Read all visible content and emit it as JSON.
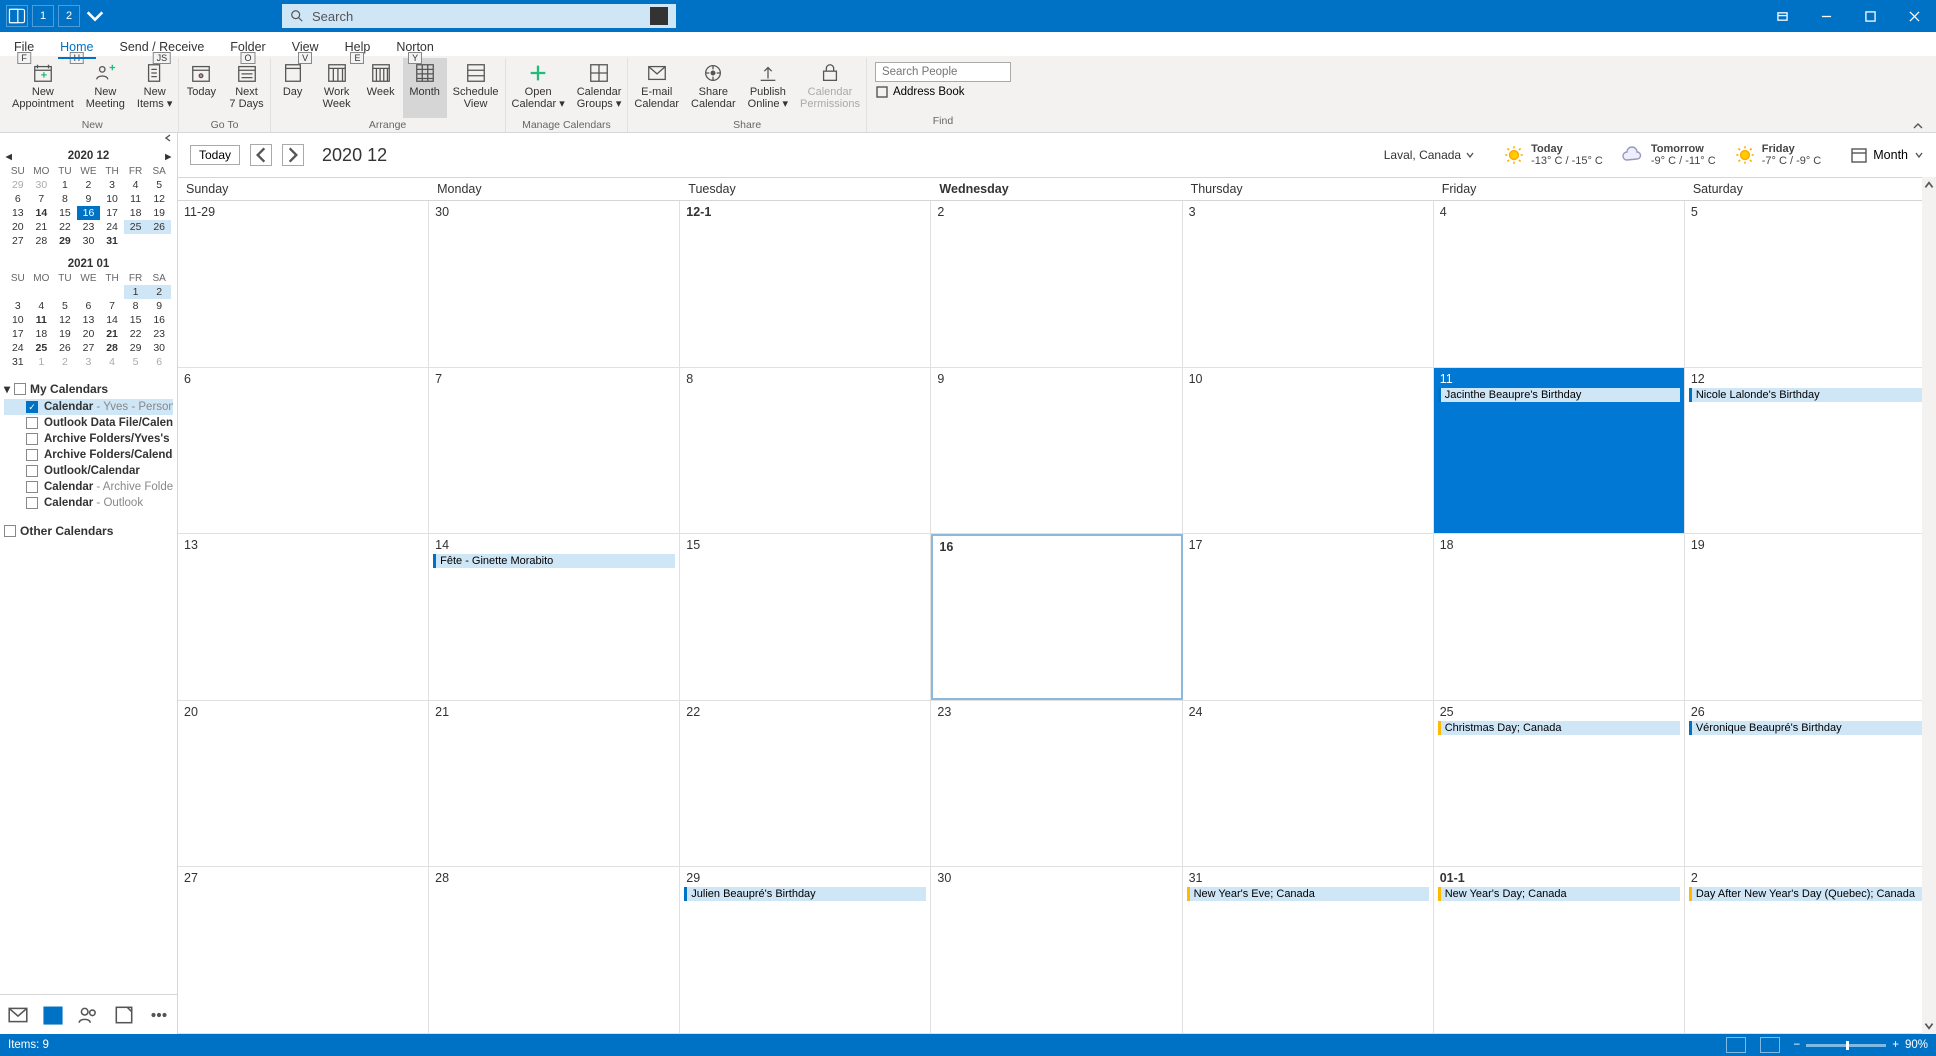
{
  "titlebar": {
    "search_placeholder": "Search",
    "qat": [
      "1",
      "2"
    ]
  },
  "tabs": {
    "items": [
      "File",
      "Home",
      "Send / Receive",
      "Folder",
      "View",
      "Help",
      "Norton"
    ],
    "active": "Home",
    "keys": [
      "F",
      "H",
      "JS",
      "O",
      "V",
      "E",
      "Y"
    ]
  },
  "ribbon": {
    "groups": [
      {
        "label": "New",
        "buttons": [
          {
            "id": "new-appointment",
            "l1": "New",
            "l2": "Appointment",
            "icon": "cal-plus"
          },
          {
            "id": "new-meeting",
            "l1": "New",
            "l2": "Meeting",
            "icon": "people-plus"
          },
          {
            "id": "new-items",
            "l1": "New",
            "l2": "Items ▾",
            "icon": "page"
          }
        ]
      },
      {
        "label": "Go To",
        "buttons": [
          {
            "id": "today",
            "l1": "Today",
            "l2": "",
            "icon": "cal-dot"
          },
          {
            "id": "next7",
            "l1": "Next",
            "l2": "7 Days",
            "icon": "cal-week"
          }
        ]
      },
      {
        "label": "Arrange",
        "buttons": [
          {
            "id": "day",
            "l1": "Day",
            "l2": "",
            "icon": "view-day"
          },
          {
            "id": "workweek",
            "l1": "Work",
            "l2": "Week",
            "icon": "view-ww"
          },
          {
            "id": "week",
            "l1": "Week",
            "l2": "",
            "icon": "view-week"
          },
          {
            "id": "month",
            "l1": "Month",
            "l2": "",
            "icon": "view-month",
            "active": true
          },
          {
            "id": "schedule",
            "l1": "Schedule",
            "l2": "View",
            "icon": "view-sched"
          }
        ]
      },
      {
        "label": "Manage Calendars",
        "buttons": [
          {
            "id": "open-cal",
            "l1": "Open",
            "l2": "Calendar ▾",
            "icon": "plus-green"
          },
          {
            "id": "cal-groups",
            "l1": "Calendar",
            "l2": "Groups ▾",
            "icon": "grid"
          }
        ]
      },
      {
        "label": "Share",
        "buttons": [
          {
            "id": "email-cal",
            "l1": "E-mail",
            "l2": "Calendar",
            "icon": "mail"
          },
          {
            "id": "share-cal",
            "l1": "Share",
            "l2": "Calendar",
            "icon": "share"
          },
          {
            "id": "publish",
            "l1": "Publish",
            "l2": "Online ▾",
            "icon": "upload"
          },
          {
            "id": "perms",
            "l1": "Calendar",
            "l2": "Permissions",
            "icon": "lock",
            "disabled": true
          }
        ]
      }
    ],
    "find": {
      "placeholder": "Search People",
      "addressbook": "Address Book",
      "label": "Find"
    }
  },
  "sidebar": {
    "mini1": {
      "title": "2020 12",
      "dow": [
        "SU",
        "MO",
        "TU",
        "WE",
        "TH",
        "FR",
        "SA"
      ],
      "rows": [
        [
          {
            "n": "29",
            "dim": true
          },
          {
            "n": "30",
            "dim": true
          },
          {
            "n": "1"
          },
          {
            "n": "2"
          },
          {
            "n": "3"
          },
          {
            "n": "4"
          },
          {
            "n": "5"
          }
        ],
        [
          {
            "n": "6"
          },
          {
            "n": "7"
          },
          {
            "n": "8"
          },
          {
            "n": "9"
          },
          {
            "n": "10"
          },
          {
            "n": "11"
          },
          {
            "n": "12"
          }
        ],
        [
          {
            "n": "13"
          },
          {
            "n": "14",
            "bold": true
          },
          {
            "n": "15"
          },
          {
            "n": "16",
            "today": true
          },
          {
            "n": "17"
          },
          {
            "n": "18"
          },
          {
            "n": "19"
          }
        ],
        [
          {
            "n": "20"
          },
          {
            "n": "21"
          },
          {
            "n": "22"
          },
          {
            "n": "23"
          },
          {
            "n": "24"
          },
          {
            "n": "25",
            "range": true
          },
          {
            "n": "26",
            "range": true
          }
        ],
        [
          {
            "n": "27"
          },
          {
            "n": "28"
          },
          {
            "n": "29",
            "bold": true
          },
          {
            "n": "30"
          },
          {
            "n": "31",
            "bold": true
          },
          {
            "n": "",
            "dim": true
          },
          {
            "n": "",
            "dim": true
          }
        ]
      ]
    },
    "mini2": {
      "title": "2021 01",
      "dow": [
        "SU",
        "MO",
        "TU",
        "WE",
        "TH",
        "FR",
        "SA"
      ],
      "rows": [
        [
          {
            "n": ""
          },
          {
            "n": ""
          },
          {
            "n": ""
          },
          {
            "n": ""
          },
          {
            "n": ""
          },
          {
            "n": "1",
            "range": true
          },
          {
            "n": "2",
            "range": true
          }
        ],
        [
          {
            "n": "3"
          },
          {
            "n": "4"
          },
          {
            "n": "5"
          },
          {
            "n": "6"
          },
          {
            "n": "7"
          },
          {
            "n": "8"
          },
          {
            "n": "9"
          }
        ],
        [
          {
            "n": "10"
          },
          {
            "n": "11",
            "bold": true
          },
          {
            "n": "12"
          },
          {
            "n": "13"
          },
          {
            "n": "14"
          },
          {
            "n": "15"
          },
          {
            "n": "16"
          }
        ],
        [
          {
            "n": "17"
          },
          {
            "n": "18"
          },
          {
            "n": "19"
          },
          {
            "n": "20"
          },
          {
            "n": "21",
            "bold": true
          },
          {
            "n": "22"
          },
          {
            "n": "23"
          }
        ],
        [
          {
            "n": "24"
          },
          {
            "n": "25",
            "bold": true
          },
          {
            "n": "26"
          },
          {
            "n": "27"
          },
          {
            "n": "28",
            "bold": true
          },
          {
            "n": "29"
          },
          {
            "n": "30"
          }
        ],
        [
          {
            "n": "31"
          },
          {
            "n": "1",
            "dim": true
          },
          {
            "n": "2",
            "dim": true
          },
          {
            "n": "3",
            "dim": true
          },
          {
            "n": "4",
            "dim": true
          },
          {
            "n": "5",
            "dim": true
          },
          {
            "n": "6",
            "dim": true
          }
        ]
      ]
    },
    "groups": {
      "mycal_label": "My Calendars",
      "other_label": "Other Calendars",
      "items": [
        {
          "name": "Calendar",
          "detail": " - Yves - Personal F...",
          "checked": true,
          "selected": true
        },
        {
          "name": "Outlook Data File/Calendar",
          "detail": "",
          "checked": false
        },
        {
          "name": "Archive Folders/Yves's cale...",
          "detail": "",
          "checked": false
        },
        {
          "name": "Archive Folders/Calendar",
          "detail": "",
          "checked": false
        },
        {
          "name": "Outlook/Calendar",
          "detail": "",
          "checked": false
        },
        {
          "name": "Calendar",
          "detail": " - Archive Folders",
          "checked": false
        },
        {
          "name": "Calendar",
          "detail": " - Outlook",
          "checked": false
        }
      ]
    }
  },
  "calheader": {
    "today": "Today",
    "title": "2020 12",
    "location": "Laval, Canada",
    "weather": [
      {
        "label": "Today",
        "temp": "-13° C / -15° C",
        "icon": "sun"
      },
      {
        "label": "Tomorrow",
        "temp": "-9° C / -11° C",
        "icon": "cloud"
      },
      {
        "label": "Friday",
        "temp": "-7° C / -9° C",
        "icon": "sun"
      }
    ],
    "viewsel": "Month"
  },
  "dayheaders": [
    "Sunday",
    "Monday",
    "Tuesday",
    "Wednesday",
    "Thursday",
    "Friday",
    "Saturday"
  ],
  "dayheader_bold_index": 3,
  "weeks": [
    [
      {
        "dn": "11-29"
      },
      {
        "dn": "30"
      },
      {
        "dn": "12-1",
        "bold": true
      },
      {
        "dn": "2"
      },
      {
        "dn": "3"
      },
      {
        "dn": "4"
      },
      {
        "dn": "5"
      }
    ],
    [
      {
        "dn": "6"
      },
      {
        "dn": "7"
      },
      {
        "dn": "8"
      },
      {
        "dn": "9"
      },
      {
        "dn": "10"
      },
      {
        "dn": "11",
        "selected": true,
        "events": [
          {
            "t": "Jacinthe Beaupre's Birthday"
          }
        ]
      },
      {
        "dn": "12",
        "events": [
          {
            "t": "Nicole Lalonde's Birthday"
          }
        ]
      }
    ],
    [
      {
        "dn": "13"
      },
      {
        "dn": "14",
        "events": [
          {
            "t": "Fête - Ginette Morabito"
          }
        ]
      },
      {
        "dn": "15"
      },
      {
        "dn": "16",
        "bold": true,
        "today": true
      },
      {
        "dn": "17"
      },
      {
        "dn": "18"
      },
      {
        "dn": "19"
      }
    ],
    [
      {
        "dn": "20"
      },
      {
        "dn": "21"
      },
      {
        "dn": "22"
      },
      {
        "dn": "23"
      },
      {
        "dn": "24"
      },
      {
        "dn": "25",
        "events": [
          {
            "t": "Christmas Day; Canada",
            "h": true
          }
        ]
      },
      {
        "dn": "26",
        "events": [
          {
            "t": "Véronique Beaupré's Birthday"
          }
        ]
      }
    ],
    [
      {
        "dn": "27"
      },
      {
        "dn": "28"
      },
      {
        "dn": "29",
        "events": [
          {
            "t": "Julien Beaupré's Birthday"
          }
        ]
      },
      {
        "dn": "30"
      },
      {
        "dn": "31",
        "events": [
          {
            "t": "New Year's Eve; Canada",
            "h": true
          }
        ]
      },
      {
        "dn": "01-1",
        "bold": true,
        "events": [
          {
            "t": "New Year's Day; Canada",
            "h": true
          }
        ]
      },
      {
        "dn": "2",
        "events": [
          {
            "t": "Day After New Year's Day (Quebec); Canada",
            "h": true
          }
        ]
      }
    ]
  ],
  "status": {
    "items": "Items: 9",
    "zoom": "90%"
  }
}
